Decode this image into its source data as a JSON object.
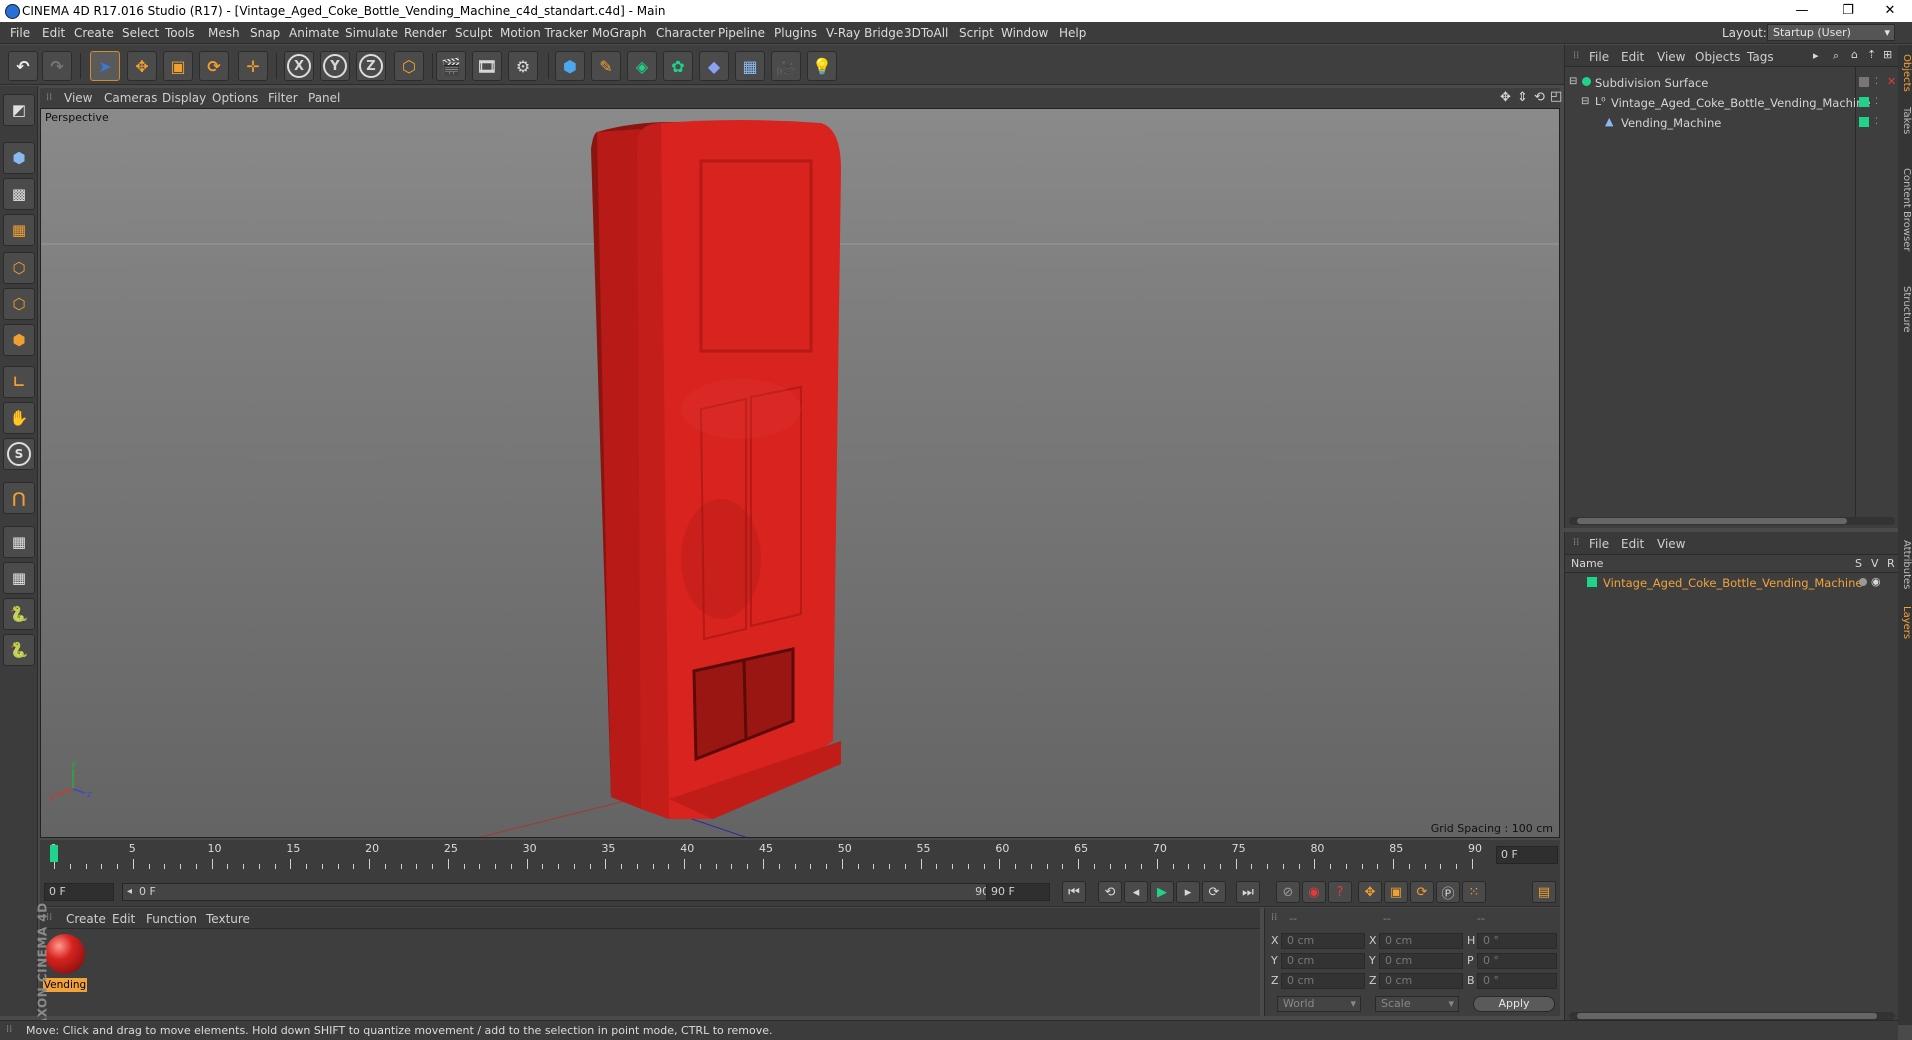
{
  "window": {
    "title": "CINEMA 4D R17.016 Studio (R17) - [Vintage_Aged_Coke_Bottle_Vending_Machine_c4d_standart.c4d] - Main",
    "minimize": "—",
    "restore": "❐",
    "close": "✕"
  },
  "menubar": {
    "items": [
      "File",
      "Edit",
      "Create",
      "Select",
      "Tools",
      "Mesh",
      "Snap",
      "Animate",
      "Simulate",
      "Render",
      "Sculpt",
      "Motion Tracker",
      "MoGraph",
      "Character",
      "Pipeline",
      "Plugins",
      "V-Ray Bridge",
      "3DToAll",
      "Script",
      "Window",
      "Help"
    ],
    "layout_label": "Layout:",
    "layout_value": "Startup (User)"
  },
  "toolbar": {
    "axis_x": "X",
    "axis_y": "Y",
    "axis_z": "Z"
  },
  "viewport": {
    "menu": [
      "View",
      "Cameras",
      "Display",
      "Options",
      "Filter",
      "Panel"
    ],
    "camera_label": "Perspective",
    "grid_spacing": "Grid Spacing : 100 cm"
  },
  "object_manager": {
    "menu": [
      "File",
      "Edit",
      "View",
      "Objects",
      "Tags"
    ],
    "objects": [
      "Subdivision Surface",
      "Vintage_Aged_Coke_Bottle_Vending_Machine",
      "Vending_Machine"
    ]
  },
  "layer_manager": {
    "menu": [
      "File",
      "Edit",
      "View"
    ],
    "col_name": "Name",
    "col_s": "S",
    "col_v": "V",
    "col_r": "R",
    "layer_name": "Vintage_Aged_Coke_Bottle_Vending_Machine"
  },
  "side_tabs": [
    "Objects",
    "Takes",
    "Content Browser",
    "Structure",
    "Attributes",
    "Layers"
  ],
  "timeline": {
    "ticks": [
      "0",
      "5",
      "10",
      "15",
      "20",
      "25",
      "30",
      "35",
      "40",
      "45",
      "50",
      "55",
      "60",
      "65",
      "70",
      "75",
      "80",
      "85",
      "90"
    ],
    "current_frame": "0 F",
    "start_field": "0 F",
    "range_start": "0 F",
    "range_end": "90 F",
    "end_field": "90 F"
  },
  "material_manager": {
    "menu": [
      "Create",
      "Edit",
      "Function",
      "Texture"
    ],
    "material_name": "Vending"
  },
  "coordinates": {
    "headers": [
      "--",
      "--",
      "--"
    ],
    "rows": [
      {
        "l1": "X",
        "v1": "0 cm",
        "l2": "X",
        "v2": "0 cm",
        "l3": "H",
        "v3": "0 °"
      },
      {
        "l1": "Y",
        "v1": "0 cm",
        "l2": "Y",
        "v2": "0 cm",
        "l3": "P",
        "v3": "0 °"
      },
      {
        "l1": "Z",
        "v1": "0 cm",
        "l2": "Z",
        "v2": "0 cm",
        "l3": "B",
        "v3": "0 °"
      }
    ],
    "mode_world": "World",
    "mode_scale": "Scale",
    "apply": "Apply"
  },
  "status": "Move: Click and drag to move elements. Hold down SHIFT to quantize movement / add to the selection in point mode, CTRL to remove.",
  "branding": "MAXON CINEMA 4D",
  "colors": {
    "accent_green": "#1fd48a",
    "selection_orange": "#f2a23a",
    "machine_red": "#d8231f"
  }
}
